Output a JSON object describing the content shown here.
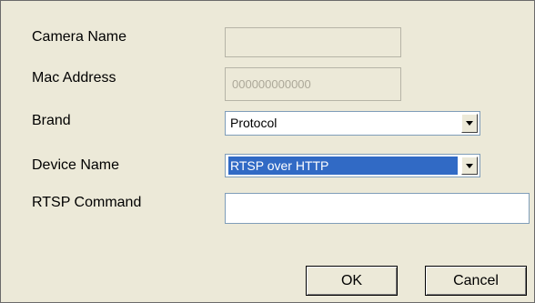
{
  "form": {
    "camera_name": {
      "label": "Camera Name",
      "value": ""
    },
    "mac_address": {
      "label": "Mac Address",
      "value": "000000000000"
    },
    "brand": {
      "label": "Brand",
      "value": "Protocol"
    },
    "device_name": {
      "label": "Device Name",
      "value": "RTSP over HTTP"
    },
    "rtsp_command": {
      "label": "RTSP Command",
      "value": ""
    }
  },
  "buttons": {
    "ok_label": "OK",
    "cancel_label": "Cancel"
  },
  "icons": {
    "dropdown": "chevron-down-icon"
  },
  "colors": {
    "dialog_background": "#ece9d8",
    "selection_highlight": "#316ac5",
    "field_border": "#7f9db9"
  }
}
